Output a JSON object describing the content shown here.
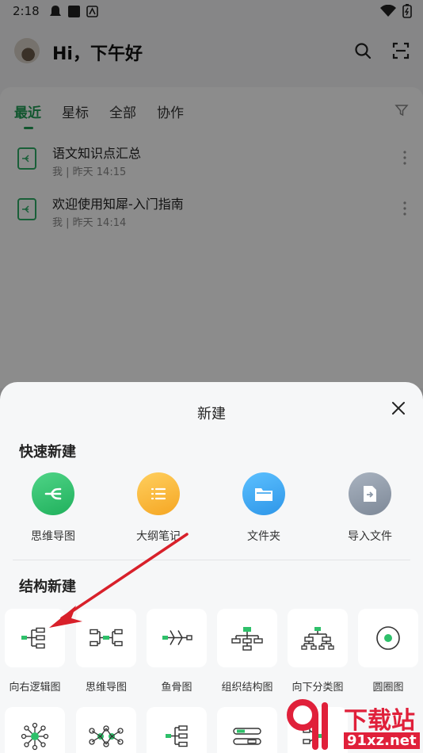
{
  "status": {
    "time": "2:18"
  },
  "header": {
    "greeting": "Hi，下午好"
  },
  "tabs": [
    "最近",
    "星标",
    "全部",
    "协作"
  ],
  "files": [
    {
      "title": "语文知识点汇总",
      "meta": "我 | 昨天 14:15"
    },
    {
      "title": "欢迎使用知犀-入门指南",
      "meta": "我 | 昨天 14:14"
    }
  ],
  "sheet": {
    "title": "新建",
    "quick_section": "快速新建",
    "quick": [
      {
        "label": "思维导图",
        "icon": "mindmap-icon",
        "color": "#2ec06a"
      },
      {
        "label": "大纲笔记",
        "icon": "outline-icon",
        "color": "#f5b33d"
      },
      {
        "label": "文件夹",
        "icon": "folder-icon",
        "color": "#3aa7ee"
      },
      {
        "label": "导入文件",
        "icon": "import-icon",
        "color": "#8c98a8"
      }
    ],
    "struct_section": "结构新建",
    "structures": [
      {
        "label": "向右逻辑图",
        "icon": "logic-right-icon"
      },
      {
        "label": "思维导图",
        "icon": "mindmap-structure-icon"
      },
      {
        "label": "鱼骨图",
        "icon": "fishbone-icon"
      },
      {
        "label": "组织结构图",
        "icon": "org-chart-icon"
      },
      {
        "label": "向下分类图",
        "icon": "tree-down-icon"
      },
      {
        "label": "圆圈图",
        "icon": "circle-map-icon"
      }
    ]
  },
  "watermark": {
    "big": "下载站",
    "small": "91xz.net"
  },
  "colors": {
    "brand_green": "#1f9d55",
    "accent_green": "#2ec06a",
    "arrow_red": "#d8202a"
  }
}
